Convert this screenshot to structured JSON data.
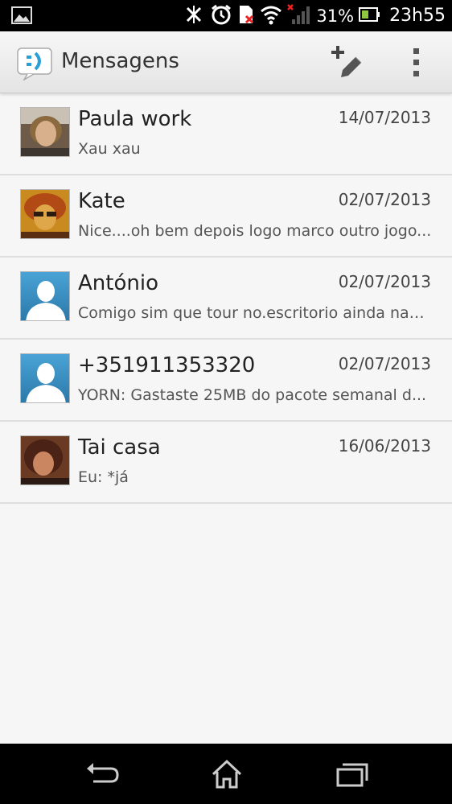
{
  "status_bar": {
    "battery_percent": "31%",
    "time": "23h55"
  },
  "action_bar": {
    "title": "Mensagens",
    "icons": [
      "messaging-app-icon",
      "new-message-icon",
      "overflow-menu-icon"
    ]
  },
  "conversations": [
    {
      "name": "Paula work",
      "date": "14/07/2013",
      "snippet": "Xau xau",
      "avatar": "photo"
    },
    {
      "name": "Kate",
      "date": "02/07/2013",
      "snippet": "Nice....oh bem depois logo marco outro jogo...",
      "avatar": "photo"
    },
    {
      "name": "António",
      "date": "02/07/2013",
      "snippet": "Comigo sim que tour no.escritorio ainda nao...",
      "avatar": "default"
    },
    {
      "name": "+351911353320",
      "date": "02/07/2013",
      "snippet": "YORN: Gastaste 25MB do pacote semanal d...",
      "avatar": "default"
    },
    {
      "name": "Tai casa",
      "date": "16/06/2013",
      "snippet": "Eu: *já",
      "avatar": "photo"
    }
  ],
  "nav_bar": {
    "icons": [
      "back-icon",
      "home-icon",
      "recent-apps-icon"
    ]
  },
  "colors": {
    "status_bar": "#000000",
    "action_bar": "#ececec",
    "list_background": "#f6f6f6",
    "divider": "#dedede",
    "default_avatar": "#3b8fc1"
  }
}
